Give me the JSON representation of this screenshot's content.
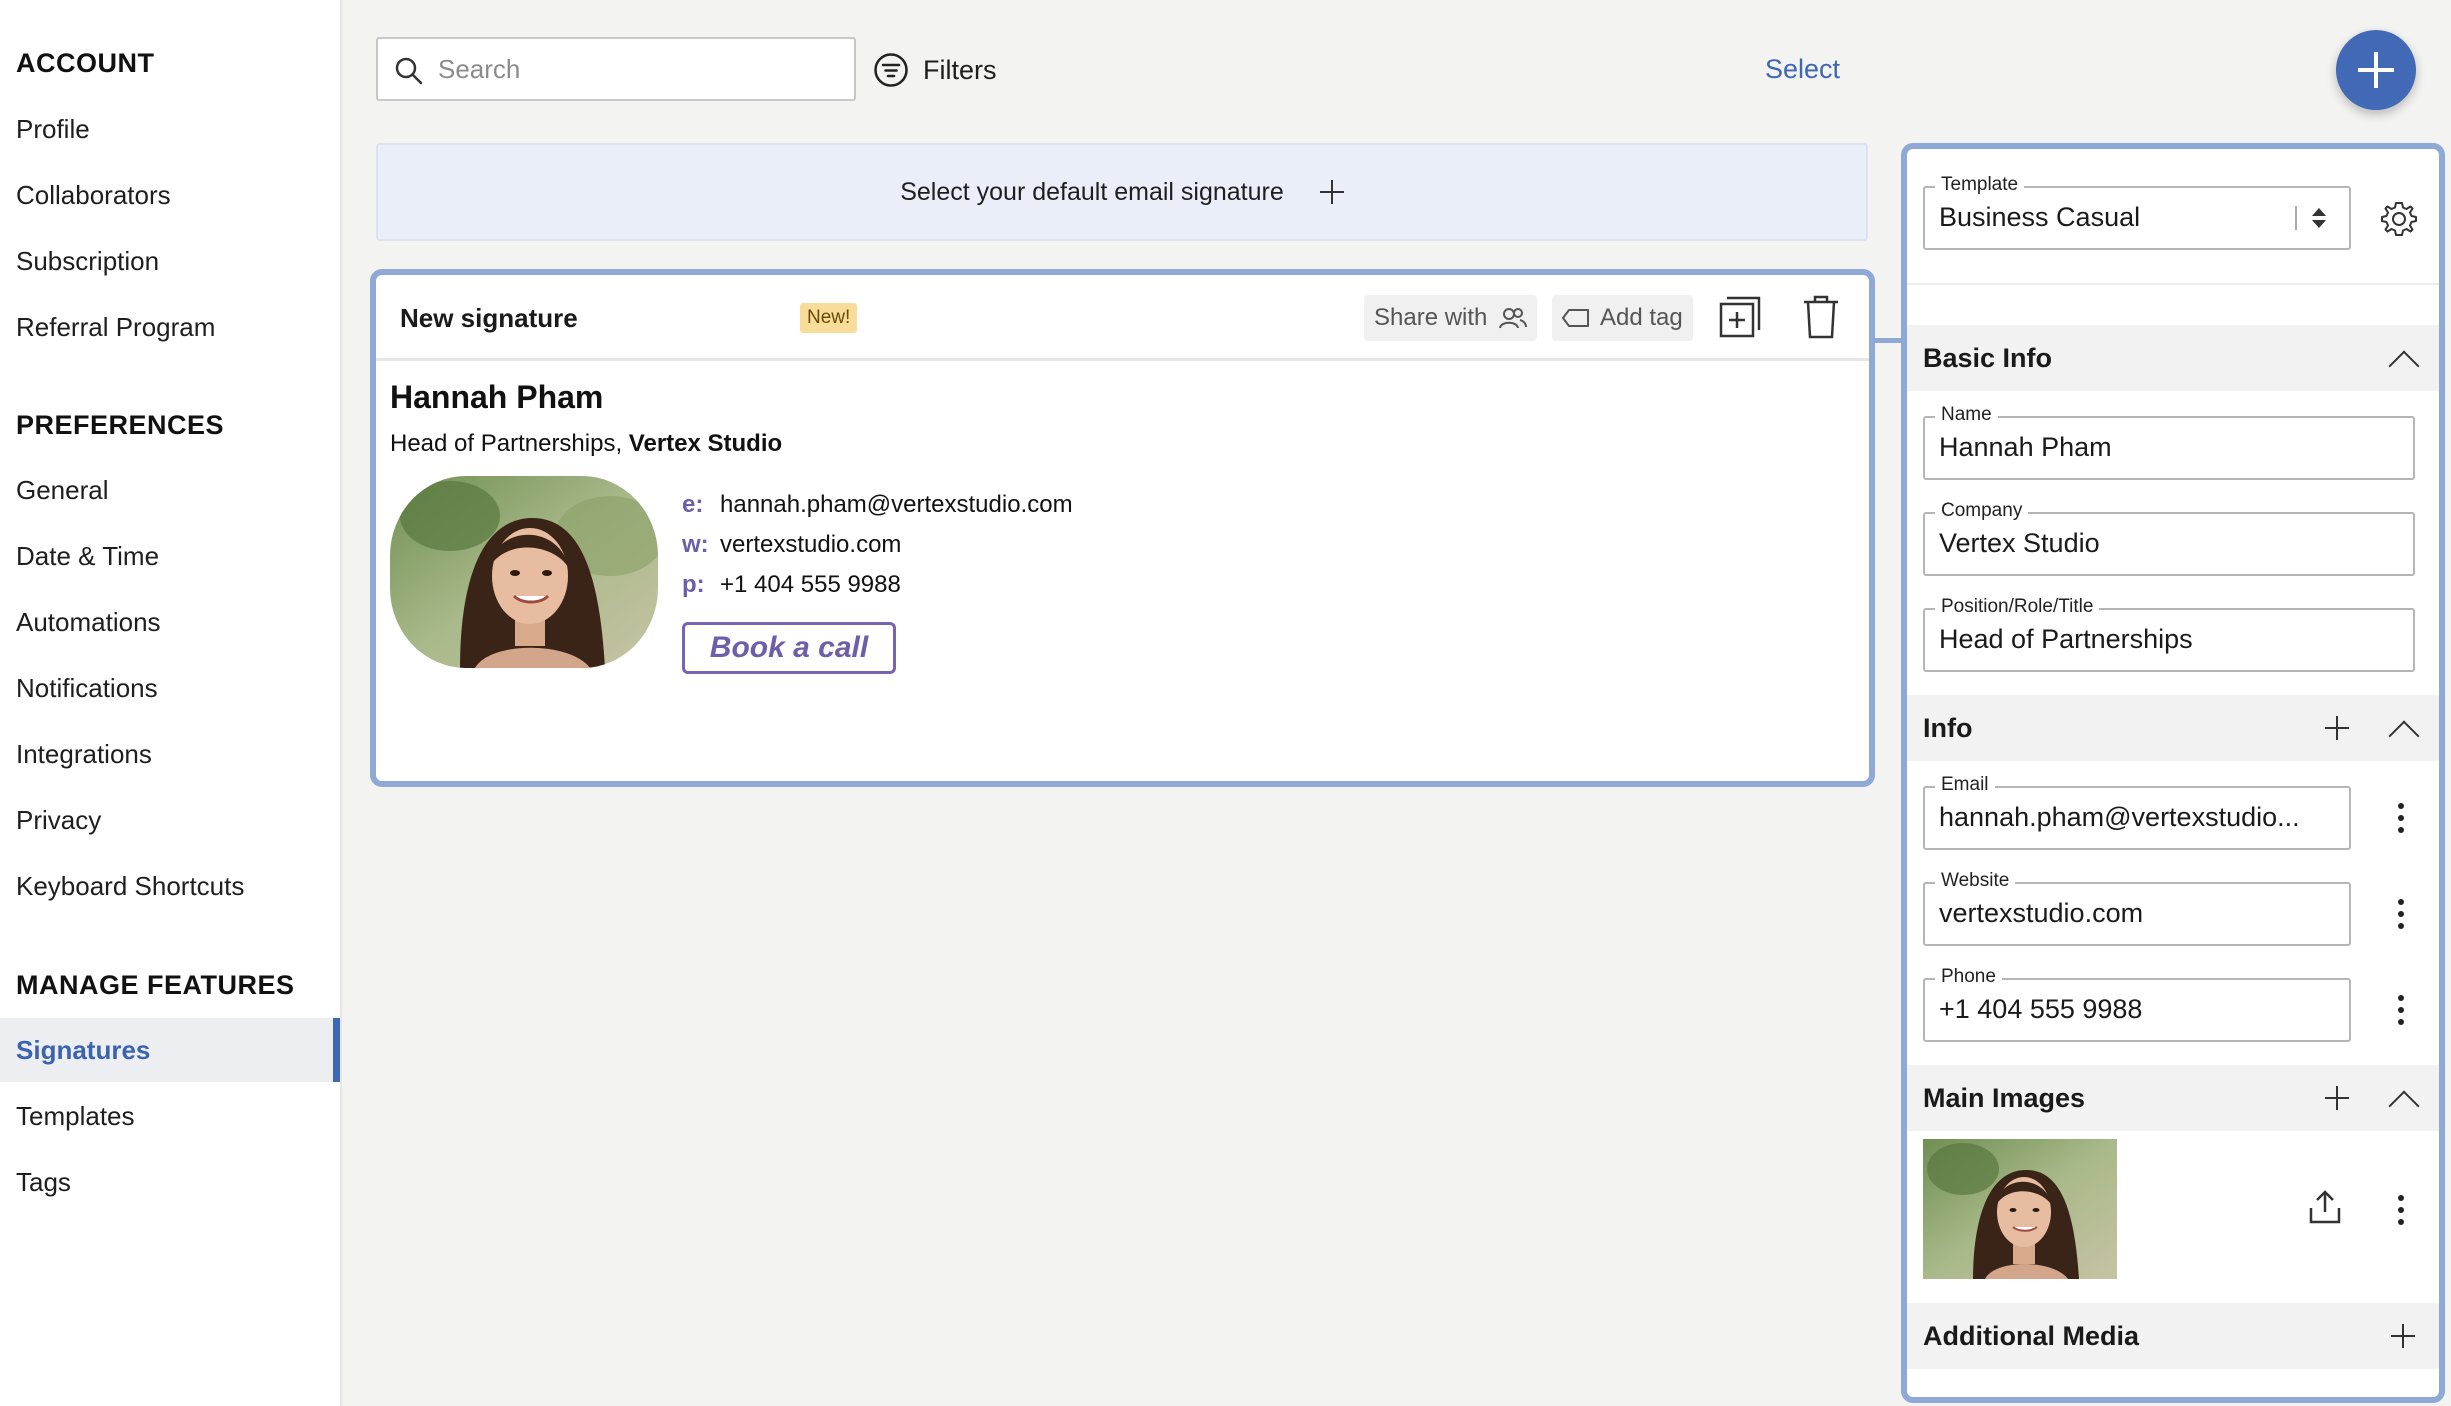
{
  "sidebar": {
    "account_heading": "ACCOUNT",
    "account_items": [
      "Profile",
      "Collaborators",
      "Subscription",
      "Referral Program"
    ],
    "preferences_heading": "PREFERENCES",
    "preferences_items": [
      "General",
      "Date & Time",
      "Automations",
      "Notifications",
      "Integrations",
      "Privacy",
      "Keyboard Shortcuts"
    ],
    "manage_heading": "MANAGE FEATURES",
    "manage_items": [
      "Signatures",
      "Templates",
      "Tags"
    ],
    "active_item": "Signatures"
  },
  "toolbar": {
    "search_placeholder": "Search",
    "filters_label": "Filters",
    "select_label": "Select"
  },
  "banner": {
    "text": "Select your default email signature"
  },
  "signature_card": {
    "title": "New signature",
    "badge": "New!",
    "share_label": "Share with",
    "tag_label": "Add tag",
    "name": "Hannah Pham",
    "role": "Head of Partnerships,",
    "company": "Vertex Studio",
    "email_label": "e:",
    "email": "hannah.pham@vertexstudio.com",
    "website_label": "w:",
    "website": "vertexstudio.com",
    "phone_label": "p:",
    "phone": "+1 404 555 9988",
    "cta_label": "Book a call"
  },
  "panel": {
    "template_label": "Template",
    "template_value": "Business Casual",
    "basic_info_title": "Basic Info",
    "name_label": "Name",
    "name_value": "Hannah Pham",
    "company_label": "Company",
    "company_value": "Vertex Studio",
    "position_label": "Position/Role/Title",
    "position_value": "Head of Partnerships",
    "info_title": "Info",
    "email_label": "Email",
    "email_value": "hannah.pham@vertexstudio...",
    "website_label": "Website",
    "website_value": "vertexstudio.com",
    "phone_label": "Phone",
    "phone_value": "+1 404 555 9988",
    "main_images_title": "Main Images",
    "additional_media_title": "Additional Media"
  },
  "colors": {
    "accent": "#4169b6",
    "card_border": "#8ea9d5",
    "cta_purple": "#6d5ea9",
    "badge_bg": "#f8dc9a"
  }
}
